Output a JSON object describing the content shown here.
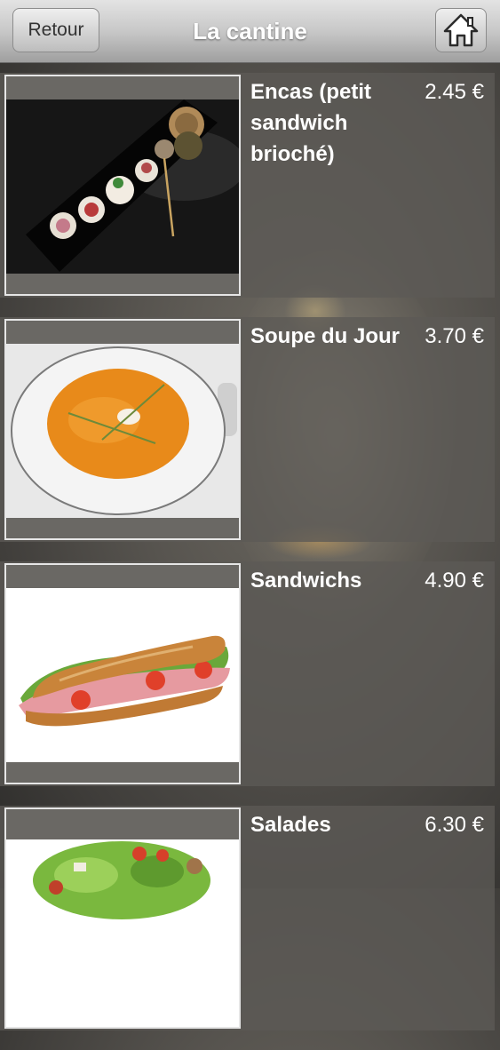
{
  "header": {
    "back_label": "Retour",
    "title": "La cantine",
    "home_icon": "home-icon"
  },
  "items": [
    {
      "name": "Encas (petit sandwich brioché)",
      "price": "2.45 €",
      "image": "appetizer-plate-photo"
    },
    {
      "name": "Soupe du Jour",
      "price": "3.70 €",
      "image": "soup-bowl-photo"
    },
    {
      "name": "Sandwichs",
      "price": "4.90 €",
      "image": "baguette-sandwich-photo"
    },
    {
      "name": "Salades",
      "price": "6.30 €",
      "image": "salad-photo"
    }
  ]
}
